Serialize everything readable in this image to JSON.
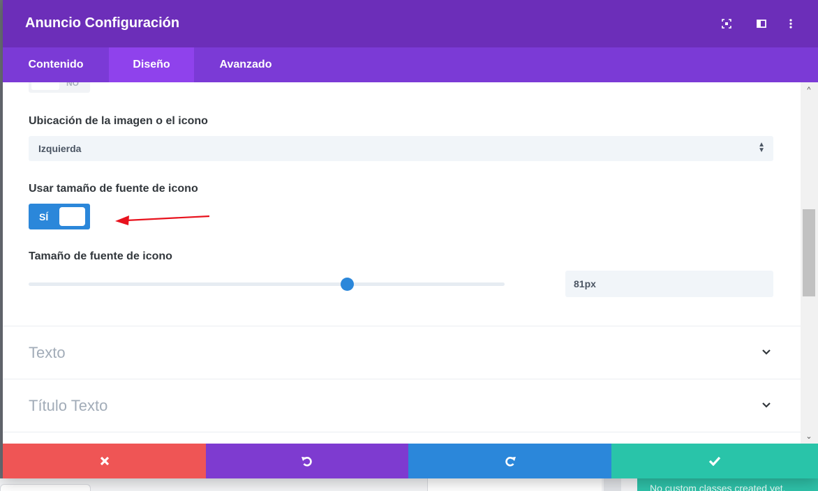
{
  "header": {
    "title": "Anuncio Configuración",
    "icons": [
      "focus-icon",
      "split-view-icon",
      "more-vertical-icon"
    ]
  },
  "tabs": [
    {
      "label": "Contenido",
      "active": false
    },
    {
      "label": "Diseño",
      "active": true
    },
    {
      "label": "Avanzado",
      "active": false
    }
  ],
  "fields": {
    "prev_toggle_label": "NO",
    "image_placement": {
      "label": "Ubicación de la imagen o el icono",
      "value": "Izquierda"
    },
    "use_icon_font_size": {
      "label": "Usar tamaño de fuente de icono",
      "value": "SÍ",
      "on": true
    },
    "icon_font_size": {
      "label": "Tamaño de fuente de icono",
      "value": "81px",
      "slider_fraction": 0.67
    }
  },
  "sections": [
    {
      "title": "Texto"
    },
    {
      "title": "Título Texto"
    }
  ],
  "footer": {
    "colors": {
      "cancel": "#ef5555",
      "undo": "#7e3bd0",
      "redo": "#2b87da",
      "save": "#29c4a9"
    }
  },
  "background": {
    "notice": "No custom classes created yet."
  },
  "colors": {
    "header": "#6c2eb9",
    "tabs": "#7b3ad6",
    "tab_active": "#8f42ec",
    "accent": "#2b87da",
    "annotation_arrow": "#e8121d"
  }
}
